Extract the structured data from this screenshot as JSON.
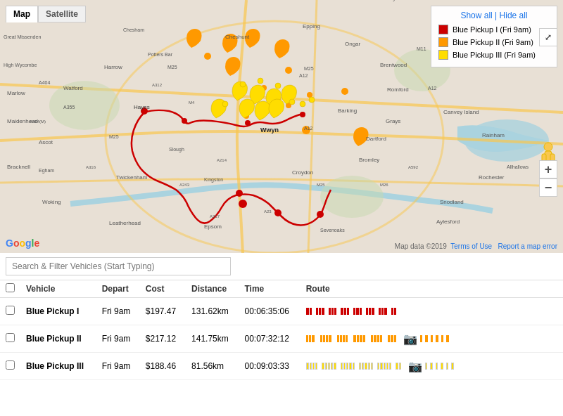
{
  "map": {
    "tabs": [
      "Map",
      "Satellite"
    ],
    "active_tab": "Map",
    "fullscreen_title": "Toggle fullscreen"
  },
  "legend": {
    "show_all": "Show all",
    "hide_all": "Hide all",
    "separator": " | ",
    "items": [
      {
        "id": "blue-pickup-1",
        "color": "red",
        "label": "Blue Pickup I (Fri 9am)"
      },
      {
        "id": "blue-pickup-2",
        "color": "orange",
        "label": "Blue Pickup II (Fri 9am)"
      },
      {
        "id": "blue-pickup-3",
        "color": "yellow",
        "label": "Blue Pickup III (Fri 9am)"
      }
    ]
  },
  "search": {
    "placeholder": "Search & Filter Vehicles (Start Typing)"
  },
  "table": {
    "headers": [
      "",
      "Vehicle",
      "Depart",
      "Cost",
      "Distance",
      "Time",
      "Route"
    ],
    "rows": [
      {
        "id": "row-1",
        "vehicle": "Blue Pickup I",
        "depart": "Fri 9am",
        "cost": "$197.47",
        "distance": "131.62km",
        "time": "00:06:35:06",
        "route_color": "red",
        "bar_pattern": [
          4,
          2,
          3,
          2,
          4,
          2,
          3,
          2,
          4,
          2,
          3,
          2,
          4,
          2,
          3,
          2,
          4,
          2,
          3,
          4,
          3,
          2,
          4
        ]
      },
      {
        "id": "row-2",
        "vehicle": "Blue Pickup II",
        "depart": "Fri 9am",
        "cost": "$217.12",
        "distance": "141.75km",
        "time": "00:07:32:12",
        "route_color": "orange",
        "bar_pattern": [
          3,
          2,
          4,
          2,
          3,
          2,
          4,
          3,
          2,
          3,
          2,
          4,
          2,
          4,
          3,
          2,
          4,
          2,
          3,
          2,
          4,
          3
        ]
      },
      {
        "id": "row-3",
        "vehicle": "Blue Pickup III",
        "depart": "Fri 9am",
        "cost": "$188.46",
        "distance": "81.56km",
        "time": "00:09:03:33",
        "route_color": "yellow",
        "bar_pattern": [
          4,
          2,
          3,
          2,
          4,
          2,
          3,
          2,
          4,
          2,
          3,
          2,
          4,
          2,
          3,
          2,
          4,
          2,
          3,
          2,
          4,
          2,
          3,
          2,
          4,
          2,
          3
        ]
      }
    ]
  },
  "google_logo": "Google",
  "attribution": "Map data ©2019  Terms of Use  Report a map error"
}
